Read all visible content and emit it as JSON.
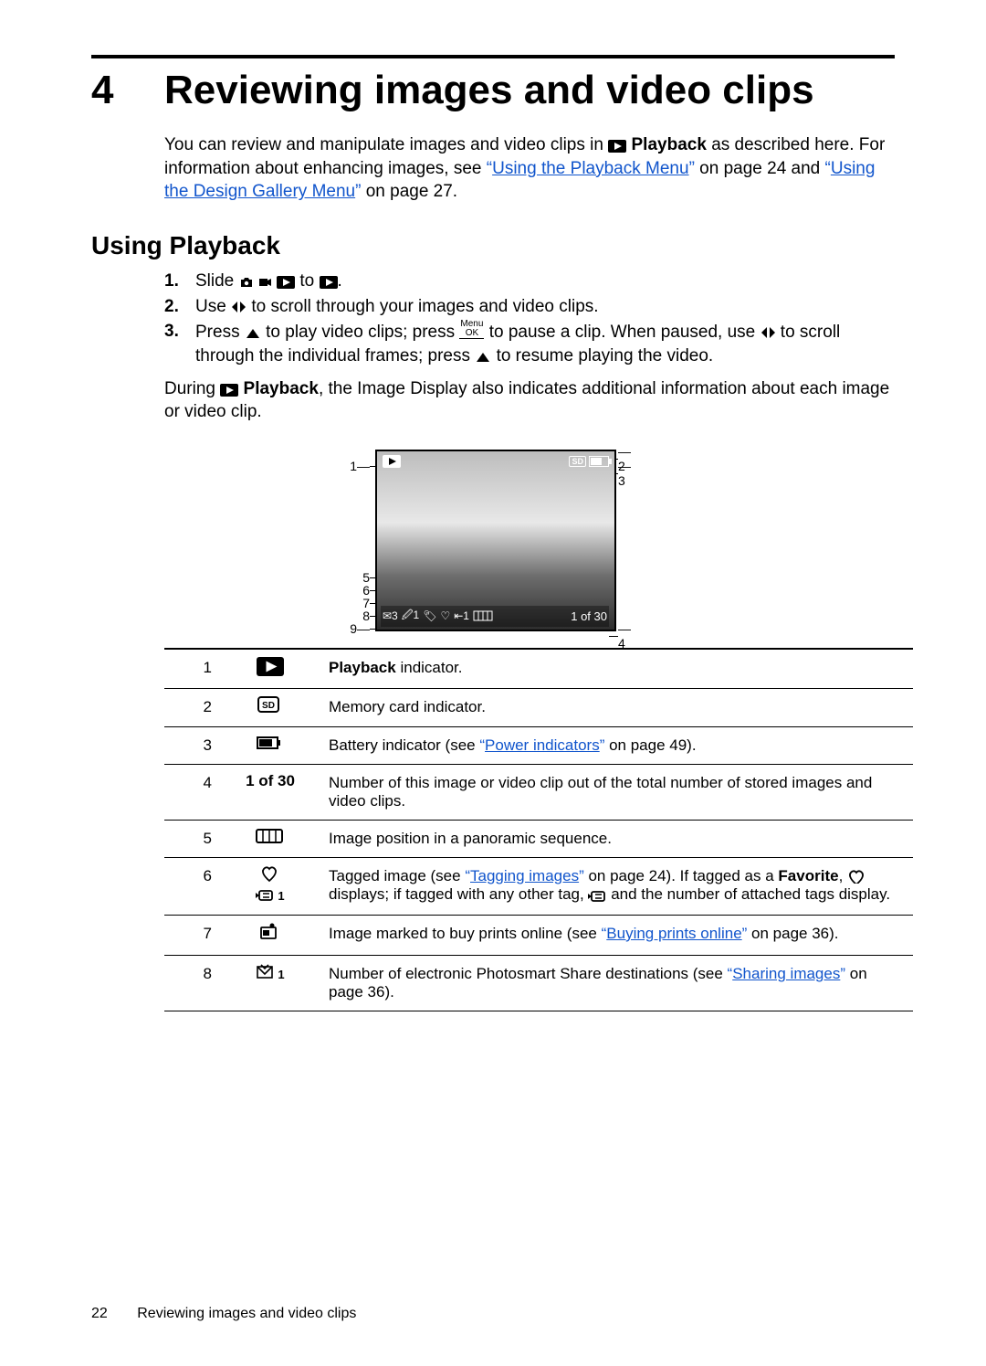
{
  "chapter": {
    "number": "4",
    "title": "Reviewing images and video clips"
  },
  "intro": {
    "p1a": "You can review and manipulate images and video clips in ",
    "playback_word": "Playback",
    "p1b": " as described here. For information about enhancing images, see ",
    "link1": "Using the Playback Menu",
    "p1c": " on page 24 and ",
    "link2": "Using the Design Gallery Menu",
    "p1d": " on page 27."
  },
  "section1_title": "Using Playback",
  "steps": {
    "s1a": "Slide ",
    "s1b": " to ",
    "s1c": ".",
    "s2a": "Use ",
    "s2b": " to scroll through your images and video clips.",
    "s3a": "Press ",
    "s3b": " to play video clips; press ",
    "s3c": " to pause a clip. When paused, use ",
    "s3d": " to scroll through the individual frames; press ",
    "s3e": " to resume playing the video."
  },
  "post_steps": {
    "a": "During ",
    "b": "Playback",
    "c": ", the Image Display also indicates additional information about each image or video clip."
  },
  "figure": {
    "counter": "1 of 30"
  },
  "table": [
    {
      "n": "1",
      "sym_name": "playback-icon",
      "desc_bold": "Playback",
      "desc_rest": " indicator."
    },
    {
      "n": "2",
      "sym_name": "sd-icon",
      "sym_text": "SD",
      "desc": "Memory card indicator."
    },
    {
      "n": "3",
      "sym_name": "battery-icon",
      "desc_a": "Battery indicator (see ",
      "link": "Power indicators",
      "desc_b": " on page 49)."
    },
    {
      "n": "4",
      "sym_text": "1 of 30",
      "desc": "Number of this image or video clip out of the total number of stored images and video clips."
    },
    {
      "n": "5",
      "sym_name": "panorama-icon",
      "desc": "Image position in a panoramic sequence."
    },
    {
      "n": "6",
      "sym_name": "heart-tag-icons",
      "desc_a": "Tagged image (see ",
      "link": "Tagging images",
      "desc_b": " on page 24). If tagged as a ",
      "bold": "Favorite",
      "desc_c": ", ",
      "desc_d": " displays; if tagged with any other tag, ",
      "desc_e": " and the number of attached tags display."
    },
    {
      "n": "7",
      "sym_name": "buy-prints-icon",
      "desc_a": "Image marked to buy prints online (see ",
      "link": "Buying prints online",
      "desc_b": " on page 36)."
    },
    {
      "n": "8",
      "sym_name": "share-icon",
      "desc_a": "Number of electronic Photosmart Share destinations (see ",
      "link": "Sharing images",
      "desc_b": " on page 36)."
    }
  ],
  "footer": {
    "page": "22",
    "title": "Reviewing images and video clips"
  }
}
